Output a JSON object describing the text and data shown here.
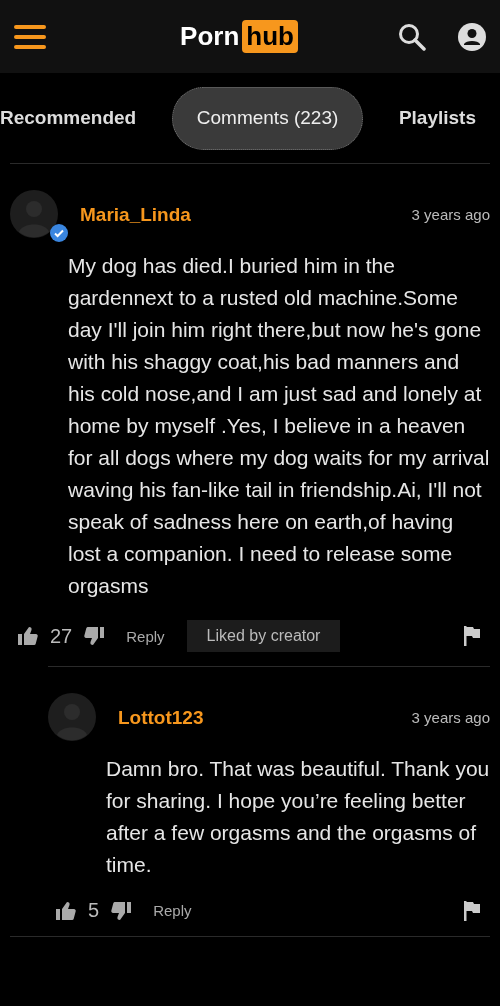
{
  "header": {
    "logo": {
      "part_1": "Porn",
      "part_2": "hub"
    }
  },
  "tabs": [
    {
      "label": "Recommended",
      "selected": false
    },
    {
      "label": "Comments (223)",
      "selected": true
    },
    {
      "label": "Playlists",
      "selected": false
    }
  ],
  "comments": [
    {
      "username": "Maria_Linda",
      "verified": true,
      "time": "3 years ago",
      "text": "My dog has died.I buried him in the gardennext to a rusted old machine.Some day I'll join him right there,but now he's gone with his shaggy coat,his bad manners and his cold nose,and I am just sad and lonely at home by myself .Yes, I believe in a heaven for all dogs where my dog waits for my arrival waving his fan-like tail in friendship.Ai, I'll not speak of sadness here on earth,of having lost a companion. I need to release some orgasms",
      "likes": "27",
      "reply_label": "Reply",
      "badge": "Liked by creator",
      "children": [
        {
          "username": "Lottot123",
          "verified": false,
          "time": "3 years ago",
          "text": "Damn bro. That was beautiful. Thank you for sharing. I hope you’re feeling better after a few orgasms and the orgasms of time.",
          "likes": "5",
          "reply_label": "Reply"
        }
      ]
    }
  ]
}
